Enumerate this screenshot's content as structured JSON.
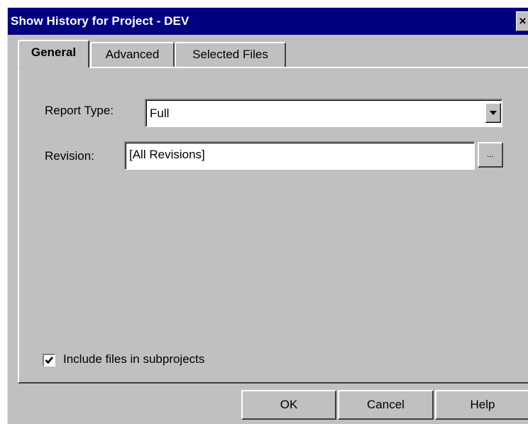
{
  "window": {
    "title": "Show History for Project - DEV",
    "close_glyph": "×"
  },
  "tabs": [
    {
      "label": "General",
      "active": true
    },
    {
      "label": "Advanced",
      "active": false
    },
    {
      "label": "Selected Files",
      "active": false
    }
  ],
  "general": {
    "report_type_label": "Report Type:",
    "report_type_value": "Full",
    "revision_label": "Revision:",
    "revision_value": "[All Revisions]",
    "browse_label": "...",
    "include_subprojects_label": "Include files in subprojects",
    "include_subprojects_checked": true
  },
  "buttons": {
    "ok": "OK",
    "cancel": "Cancel",
    "help": "Help"
  },
  "icons": {
    "dropdown": "chevron-down-icon",
    "check": "checkmark-icon",
    "close": "close-icon"
  }
}
